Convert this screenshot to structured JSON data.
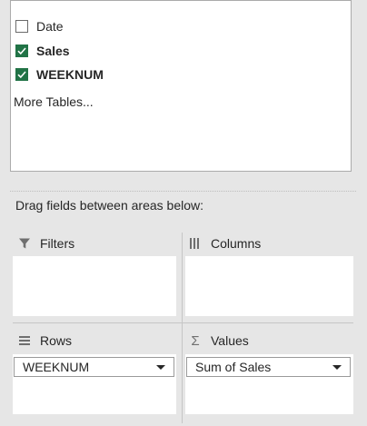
{
  "field_list": {
    "items": [
      {
        "label": "Date",
        "checked": false
      },
      {
        "label": "Sales",
        "checked": true
      },
      {
        "label": "WEEKNUM",
        "checked": true
      }
    ],
    "more_tables": "More Tables..."
  },
  "drag_label": "Drag fields between areas below:",
  "areas": {
    "filters": {
      "label": "Filters",
      "icon": "filter-icon"
    },
    "columns": {
      "label": "Columns",
      "icon": "columns-icon"
    },
    "rows": {
      "label": "Rows",
      "icon": "rows-icon",
      "fields": [
        "WEEKNUM"
      ]
    },
    "values": {
      "label": "Values",
      "icon": "sigma-icon",
      "fields": [
        "Sum of Sales"
      ]
    }
  },
  "colors": {
    "checkbox_checked": "#217346",
    "panel_bg": "#e6e6e6"
  }
}
